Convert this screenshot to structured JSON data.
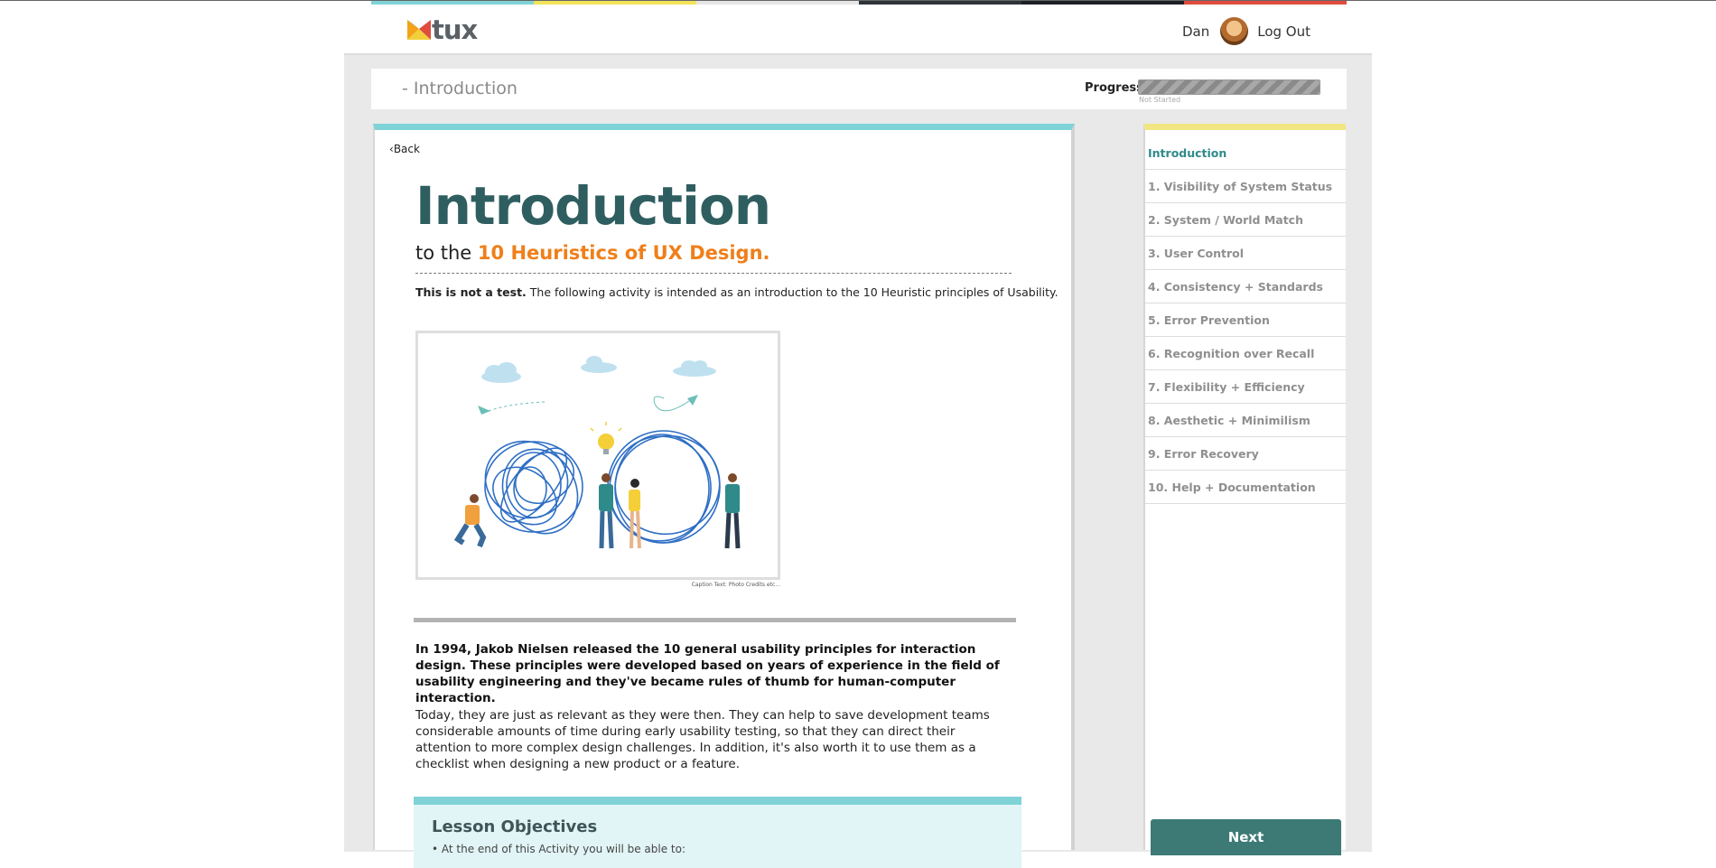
{
  "header": {
    "stripe_colors": [
      "#7fd3d6",
      "#f1e35a",
      "#e6e6e6",
      "#2e3338",
      "#1c2026",
      "#e14c3d"
    ],
    "logo_text": "tux",
    "user_name": "Dan",
    "logout_label": "Log Out"
  },
  "titlebar": {
    "breadcrumb": "- Introduction",
    "progress_label": "Progress",
    "progress_value": 0,
    "progress_status": "Not Started"
  },
  "content": {
    "back_label": "Back",
    "title": "Introduction",
    "subtitle_prefix": "to the ",
    "subtitle_highlight": "10 Heuristics of UX Design",
    "subtitle_suffix": ".",
    "intro_bold": "This is not a test.",
    "intro_rest": " The following activity is intended as an introduction to the 10 Heuristic principles of Usability.",
    "image_caption": "Caption Text: Photo Credits etc...",
    "paragraph1": "In 1994, Jakob Nielsen released the 10 general usability principles for interaction design. These principles were developed based on years of experience in the field of usability engineering and they've became rules of thumb for human-computer interaction.",
    "paragraph2": "Today, they are just as relevant as they were then. They can help to save development teams considerable amounts of time during early usability testing, so that they can direct their attention to more complex design challenges. In addition, it's also worth it to use them as a checklist when designing a new product or a feature.",
    "objectives_title": "Lesson Objectives",
    "objectives_line": "• At the end of this Activity you will be able to:"
  },
  "sidebar": {
    "items": [
      {
        "label": "Introduction"
      },
      {
        "label": "1. Visibility of System Status"
      },
      {
        "label": "2. System / World Match"
      },
      {
        "label": "3. User Control"
      },
      {
        "label": "4. Consistency + Standards"
      },
      {
        "label": "5. Error Prevention"
      },
      {
        "label": "6. Recognition over Recall"
      },
      {
        "label": "7. Flexibility + Efficiency"
      },
      {
        "label": "8. Aesthetic + Minimilism"
      },
      {
        "label": "9. Error Recovery"
      },
      {
        "label": "10. Help + Documentation"
      }
    ],
    "active_index": 0,
    "next_label": "Next"
  }
}
